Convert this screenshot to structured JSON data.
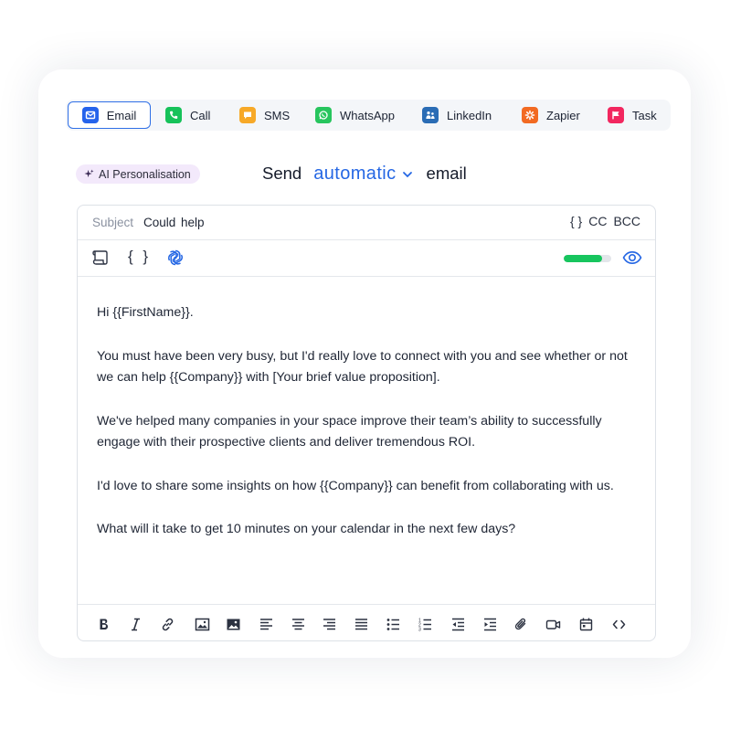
{
  "channels": [
    {
      "label": "Email",
      "icon": "email-icon",
      "color": "#2563eb",
      "active": true
    },
    {
      "label": "Call",
      "icon": "phone-icon",
      "color": "#16c25a"
    },
    {
      "label": "SMS",
      "icon": "chat-icon",
      "color": "#f7a928"
    },
    {
      "label": "WhatsApp",
      "icon": "whatsapp-icon",
      "color": "#27c55e"
    },
    {
      "label": "LinkedIn",
      "icon": "linkedin-icon",
      "color": "#2a6cb5"
    },
    {
      "label": "Zapier",
      "icon": "zapier-icon",
      "color": "#f26a22"
    },
    {
      "label": "Task",
      "icon": "flag-icon",
      "color": "#f2275f"
    }
  ],
  "ai": {
    "label": "AI Personalisation",
    "icon": "sparkle-icon"
  },
  "send": {
    "prefix": "Send",
    "mode": "automatic",
    "suffix": "email"
  },
  "subject": {
    "label": "Subject",
    "value": "Could help"
  },
  "subject_actions": {
    "variables": "{ }",
    "cc": "CC",
    "bcc": "BCC"
  },
  "toolbar": {
    "variables": "{ }",
    "progress": 0.8
  },
  "body": [
    "Hi {{FirstName}}.",
    "You must have been very busy, but I'd really love to connect with you and see whether or not we can help {{Company}} with [Your brief value proposition].",
    "We've helped many companies in your space improve their team’s ability to successfully engage with their prospective clients and deliver tremendous ROI.",
    "I'd love to share some insights on how {{Company}} can benefit from collaborating with us.",
    "What will it take to get 10 minutes on your calendar in the next few days?"
  ],
  "format_tools": [
    "bold-icon",
    "italic-icon",
    "link-icon",
    "image-icon",
    "image-fill-icon",
    "align-left-icon",
    "align-center-icon",
    "align-right-icon",
    "align-justify-icon",
    "bullet-list-icon",
    "numbered-list-icon",
    "outdent-icon",
    "indent-icon",
    "attachment-icon",
    "video-icon",
    "calendar-icon",
    "code-icon"
  ],
  "colors": {
    "accent": "#2567e4",
    "progress": "#17c55e",
    "ai_pill": "#f3e9fb"
  }
}
